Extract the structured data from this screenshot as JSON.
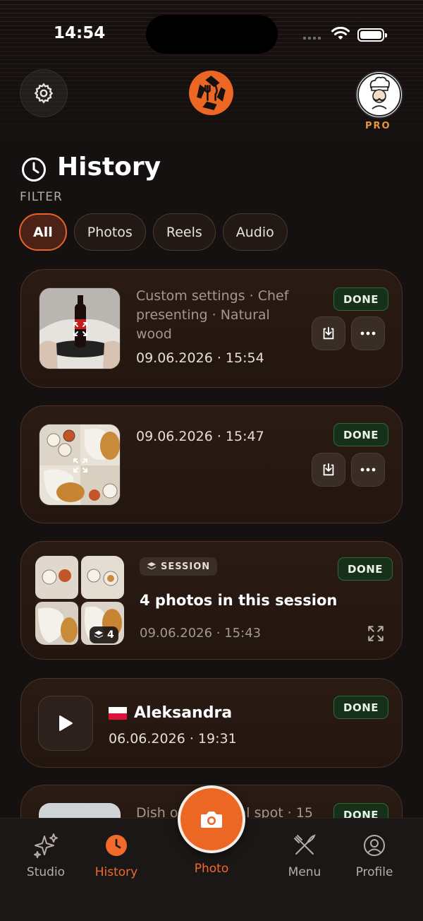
{
  "status_bar": {
    "time": "14:54"
  },
  "header": {
    "badge": "PRO"
  },
  "page": {
    "title": "History",
    "filter_label": "FILTER"
  },
  "filters": [
    {
      "label": "All",
      "active": true
    },
    {
      "label": "Photos",
      "active": false
    },
    {
      "label": "Reels",
      "active": false
    },
    {
      "label": "Audio",
      "active": false
    }
  ],
  "cards": [
    {
      "description": "Custom settings · Chef presenting · Natural wood",
      "date": "09.06.2026 · 15:54",
      "status": "DONE"
    },
    {
      "date": "09.06.2026 · 15:47",
      "status": "DONE"
    },
    {
      "badge": "SESSION",
      "title": "4 photos in this session",
      "date": "09.06.2026 · 15:43",
      "status": "DONE",
      "count": "4"
    },
    {
      "name": "Aleksandra",
      "date": "06.06.2026 · 19:31",
      "status": "DONE"
    },
    {
      "description": "Dish on a special spot · 15",
      "status": "DONE"
    }
  ],
  "nav": {
    "studio": "Studio",
    "history": "History",
    "photo": "Photo",
    "menu": "Menu",
    "profile": "Profile"
  },
  "colors": {
    "accent": "#ec6624",
    "done_bg": "#173019",
    "card_bg": "#2a1b14"
  }
}
